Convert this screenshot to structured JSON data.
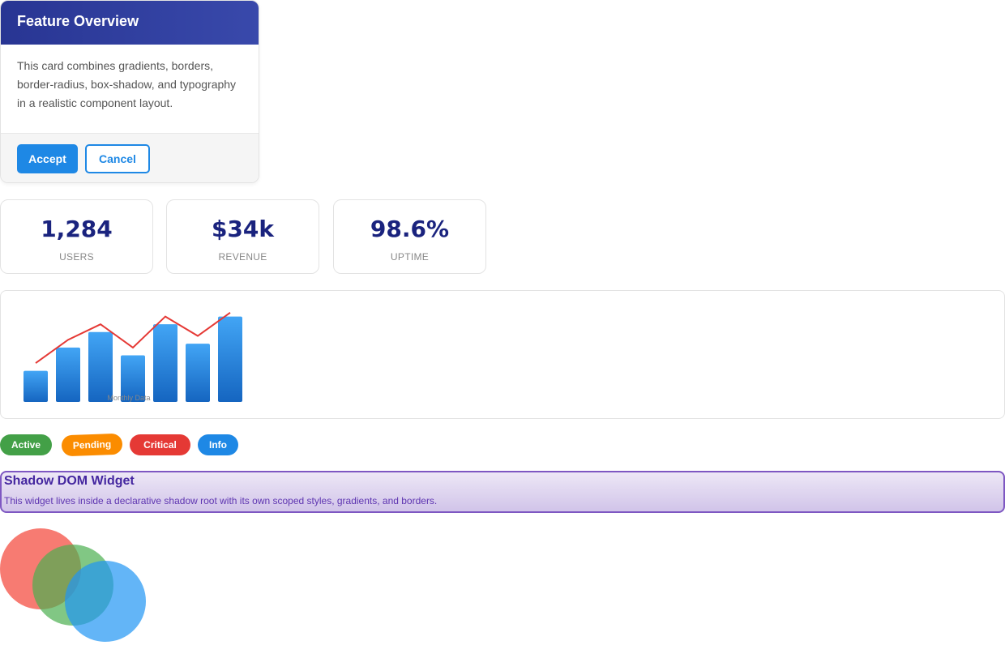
{
  "card": {
    "title": "Feature Overview",
    "description": "This card combines gradients, borders, border-radius, box-shadow, and typography in a realistic component layout.",
    "accept_label": "Accept",
    "cancel_label": "Cancel"
  },
  "stats": [
    {
      "value": "1,284",
      "label": "USERS"
    },
    {
      "value": "$34k",
      "label": "REVENUE"
    },
    {
      "value": "98.6%",
      "label": "UPTIME"
    }
  ],
  "chart_data": {
    "type": "bar",
    "title": "",
    "caption": "Monthly Data",
    "categories": [
      "",
      "",
      "",
      "",
      "",
      "",
      ""
    ],
    "series": [
      {
        "type": "bar",
        "values": [
          40,
          70,
          90,
          60,
          100,
          75,
          110
        ],
        "color": "#1e88e5"
      },
      {
        "type": "line",
        "values": [
          50,
          80,
          100,
          70,
          110,
          85,
          115
        ],
        "color": "#e53935"
      }
    ],
    "ylim": [
      0,
      120
    ],
    "grid": false,
    "legend": "none"
  },
  "badges": [
    {
      "label": "Active",
      "color": "#43a047"
    },
    {
      "label": "Pending",
      "color": "#fb8c00"
    },
    {
      "label": "Critical",
      "color": "#e53935"
    },
    {
      "label": "Info",
      "color": "#1e88e5"
    }
  ],
  "widget": {
    "title": "Shadow DOM Widget",
    "text": "This widget lives inside a declarative shadow root with its own scoped styles, gradients, and borders."
  },
  "circles": [
    {
      "color": "#f44336"
    },
    {
      "color": "#4caf50"
    },
    {
      "color": "#2196f3"
    }
  ]
}
